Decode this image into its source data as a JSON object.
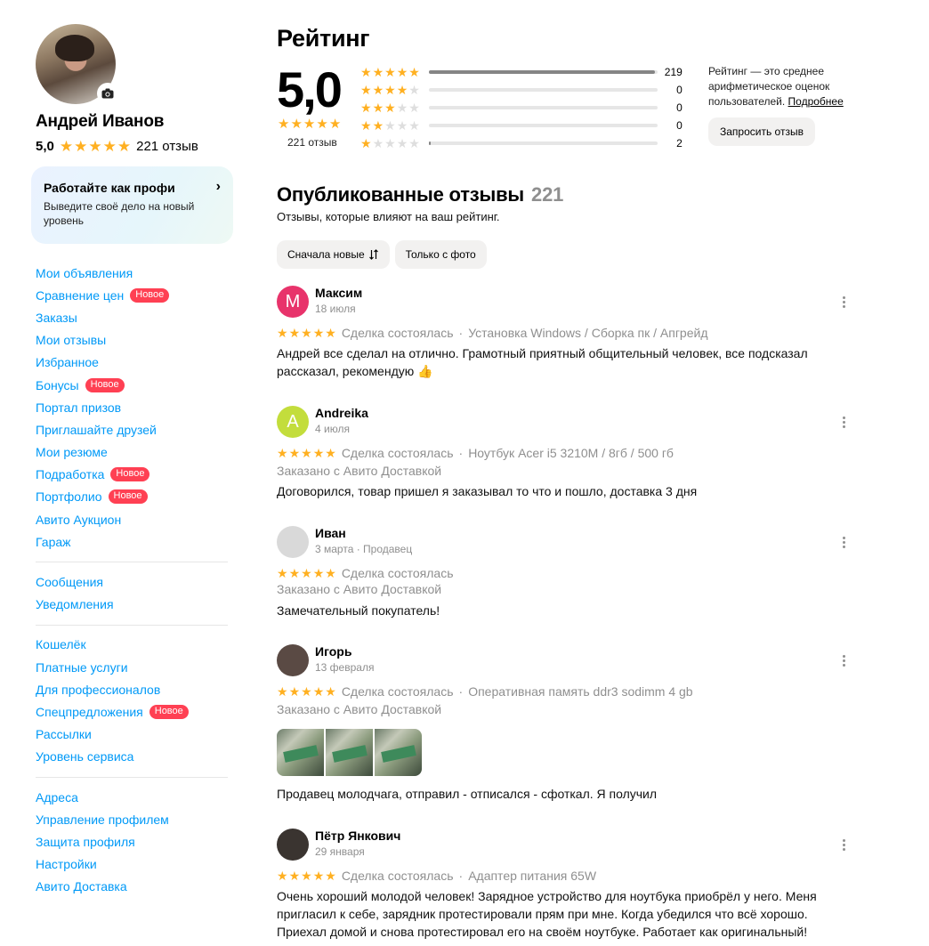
{
  "profile": {
    "name": "Андрей Иванов",
    "score": "5,0",
    "stars": 5,
    "reviews_label": "221 отзыв"
  },
  "promo": {
    "title": "Работайте как профи",
    "text": "Выведите своё дело на новый уровень",
    "arrow": "›"
  },
  "nav_groups": [
    [
      {
        "label": "Мои объявления"
      },
      {
        "label": "Сравнение цен",
        "badge": "Новое"
      },
      {
        "label": "Заказы"
      },
      {
        "label": "Мои отзывы"
      },
      {
        "label": "Избранное"
      },
      {
        "label": "Бонусы",
        "badge": "Новое"
      },
      {
        "label": "Портал призов"
      },
      {
        "label": "Приглашайте друзей"
      },
      {
        "label": "Мои резюме"
      },
      {
        "label": "Подработка",
        "badge": "Новое"
      },
      {
        "label": "Портфолио",
        "badge": "Новое"
      },
      {
        "label": "Авито Аукцион"
      },
      {
        "label": "Гараж"
      }
    ],
    [
      {
        "label": "Сообщения"
      },
      {
        "label": "Уведомления"
      }
    ],
    [
      {
        "label": "Кошелёк"
      },
      {
        "label": "Платные услуги"
      },
      {
        "label": "Для профессионалов"
      },
      {
        "label": "Спецпредложения",
        "badge": "Новое"
      },
      {
        "label": "Рассылки"
      },
      {
        "label": "Уровень сервиса"
      }
    ],
    [
      {
        "label": "Адреса"
      },
      {
        "label": "Управление профилем"
      },
      {
        "label": "Защита профиля"
      },
      {
        "label": "Настройки"
      },
      {
        "label": "Авито Доставка"
      }
    ]
  ],
  "rating": {
    "title": "Рейтинг",
    "score": "5,0",
    "count_label": "221 отзыв",
    "distribution": [
      {
        "stars": 5,
        "count": 219,
        "fraction": 0.991
      },
      {
        "stars": 4,
        "count": 0,
        "fraction": 0
      },
      {
        "stars": 3,
        "count": 0,
        "fraction": 0
      },
      {
        "stars": 2,
        "count": 0,
        "fraction": 0
      },
      {
        "stars": 1,
        "count": 2,
        "fraction": 0.009
      }
    ],
    "note": "Рейтинг — это среднее арифметическое оценок пользователей.",
    "note_link": "Подробнее",
    "request_button": "Запросить отзыв"
  },
  "reviews_section": {
    "title": "Опубликованные отзывы",
    "count": "221",
    "subtitle": "Отзывы, которые влияют на ваш рейтинг.",
    "filters": [
      "Сначала новые",
      "Только с фото"
    ]
  },
  "reviews": [
    {
      "name": "Максим",
      "initial": "M",
      "avatar_color": "#e8336b",
      "date": "18 июля",
      "status": "Сделка состоялась",
      "item": "Установка Windows / Сборка пк / Апгрейд",
      "delivery": "",
      "text": "Андрей все сделал на отлично. Грамотный приятный общительный человек, все подсказал рассказал, рекомендую 👍"
    },
    {
      "name": "Andreika",
      "initial": "A",
      "avatar_color": "#c3dd3c",
      "date": "4 июля",
      "status": "Сделка состоялась",
      "item": "Ноутбук Acer i5 3210M / 8гб / 500 гб",
      "delivery": "Заказано с Авито Доставкой",
      "text": "Договорился, товар пришел я заказывал то что и пошло, доставка 3 дня"
    },
    {
      "name": "Иван",
      "initial": "",
      "avatar_color": "#d9d9d9",
      "date": "3 марта · Продавец",
      "status": "Сделка состоялась",
      "item": "",
      "delivery": "Заказано с Авито Доставкой",
      "text": "Замечательный покупатель!"
    },
    {
      "name": "Игорь",
      "initial": "",
      "avatar_color": "#5a4a44",
      "date": "13 февраля",
      "status": "Сделка состоялась",
      "item": "Оперативная память ddr3 sodimm 4 gb",
      "delivery": "Заказано с Авито Доставкой",
      "text": "Продавец молодчага, отправил - отписался - сфоткал. Я получил"
    },
    {
      "name": "Пётр Янкович",
      "initial": "",
      "avatar_color": "#3a3430",
      "date": "29 января",
      "status": "Сделка состоялась",
      "item": "Адаптер питания 65W",
      "delivery": "",
      "text": "Очень хороший молодой человек! Зарядное устройство для ноутбука приобрёл у него. Меня пригласил к себе, зарядник протестировали прям при мне. Когда убедился что всё хорошо. Приехал домой и снова протестировал его на своём ноутбуке. Работает как оригинальный!"
    }
  ],
  "colors": {
    "link": "#0099f7",
    "star": "#ffb021",
    "badge": "#ff4053",
    "muted": "#8f8f8f"
  }
}
